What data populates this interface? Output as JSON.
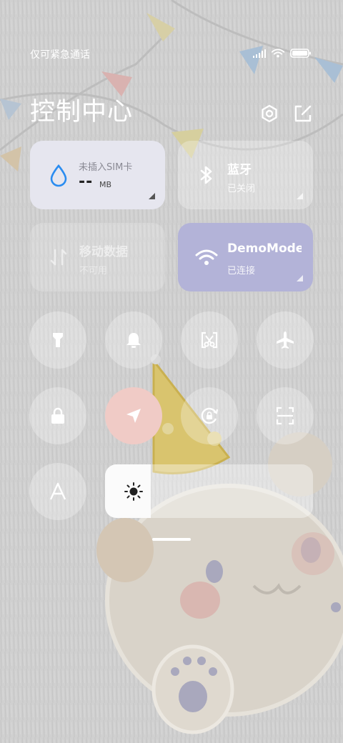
{
  "status_bar": {
    "carrier_text": "仅可紧急通话",
    "icons": [
      "signal-icon",
      "wifi-icon",
      "battery-icon"
    ]
  },
  "header": {
    "title": "控制中心",
    "buttons": [
      "settings-icon",
      "edit-icon"
    ]
  },
  "tiles": {
    "data_usage": {
      "label": "未插入SIM卡",
      "value": "--",
      "unit": "MB",
      "icon": "water-drop-icon"
    },
    "bluetooth": {
      "title": "蓝牙",
      "status": "已关闭",
      "icon": "bluetooth-icon"
    },
    "mobile_data": {
      "title": "移动数据",
      "status": "不可用",
      "icon": "data-arrows-icon"
    },
    "wifi": {
      "title": "DemoMode",
      "status": "已连接",
      "icon": "wifi-icon"
    }
  },
  "toggles": [
    {
      "name": "flashlight",
      "icon": "flashlight-icon",
      "on": false
    },
    {
      "name": "ringer",
      "icon": "bell-icon",
      "on": false
    },
    {
      "name": "screenshot",
      "icon": "screenshot-icon",
      "on": false
    },
    {
      "name": "airplane-mode",
      "icon": "airplane-icon",
      "on": false
    },
    {
      "name": "lock-screen",
      "icon": "lock-icon",
      "on": false
    },
    {
      "name": "location",
      "icon": "location-arrow-icon",
      "on": true
    },
    {
      "name": "rotation-lock",
      "icon": "rotation-lock-icon",
      "on": false
    },
    {
      "name": "scanner",
      "icon": "scan-icon",
      "on": false
    },
    {
      "name": "auto-brightness",
      "icon": "auto-brightness-icon",
      "on": false
    }
  ],
  "brightness": {
    "level": 0.22,
    "icon": "sun-icon"
  },
  "colors": {
    "data_tile_bg": "#e6e6ef",
    "wifi_tile_bg": "#b3b3d8",
    "location_active_bg": "#f0cbc6",
    "drop_icon": "#2a8cf0"
  }
}
